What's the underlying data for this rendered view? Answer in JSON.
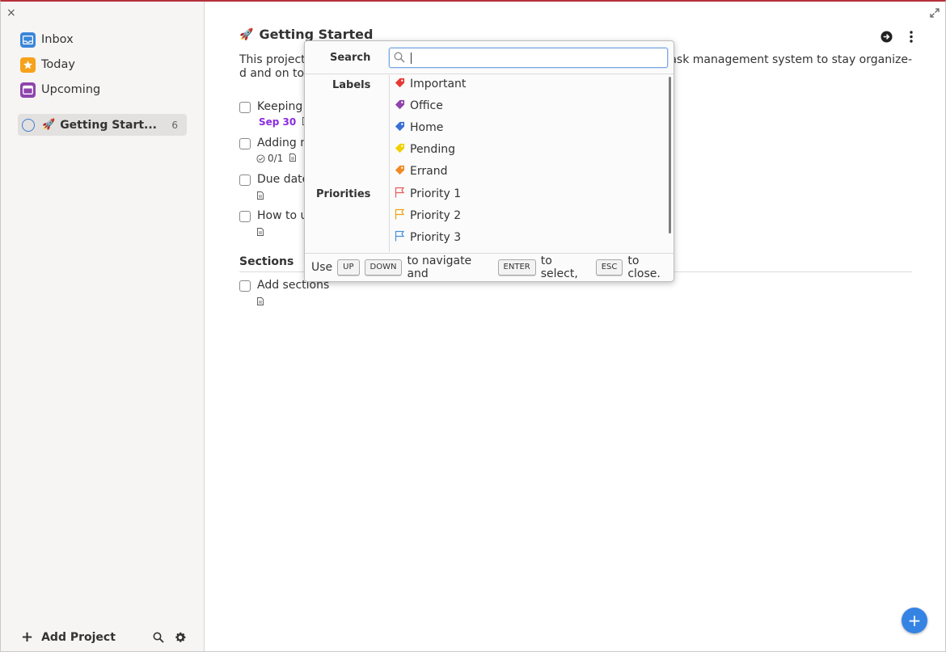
{
  "sidebar": {
    "close_glyph": "×",
    "nav": [
      {
        "label": "Inbox",
        "icon": "inbox-icon",
        "color": "#3a86d8"
      },
      {
        "label": "Today",
        "icon": "star-icon",
        "color": "#f6a21a"
      },
      {
        "label": "Upcoming",
        "icon": "calendar-icon",
        "color": "#8e44ad"
      }
    ],
    "project": {
      "emoji": "🚀",
      "label": "Getting Start...",
      "count": "6"
    },
    "footer": {
      "add_label": "Add Project",
      "plus": "+"
    }
  },
  "main": {
    "title_emoji": "🚀",
    "title": "Getting Started",
    "description_left": "This project",
    "description_right": "e task management system to stay organize-",
    "description_line2": "d and on top",
    "tasks": [
      {
        "text": "Keeping t",
        "due": "Sep 30"
      },
      {
        "text": "Adding n",
        "subtasks": "0/1"
      },
      {
        "text": "Due date"
      },
      {
        "text": "How to u"
      }
    ],
    "section_title": "Sections",
    "section_tasks": [
      {
        "text": "Add sections"
      }
    ],
    "fab_label": "+"
  },
  "popup": {
    "search_label": "Search",
    "search_value": "",
    "labels_heading": "Labels",
    "priorities_heading": "Priorities",
    "labels": [
      {
        "label": "Important",
        "color": "#e53935"
      },
      {
        "label": "Office",
        "color": "#8e44ad"
      },
      {
        "label": "Home",
        "color": "#3a6fd8"
      },
      {
        "label": "Pending",
        "color": "#f0d000"
      },
      {
        "label": "Errand",
        "color": "#f08a24"
      }
    ],
    "priorities": [
      {
        "label": "Priority 1",
        "color": "#e85a5a"
      },
      {
        "label": "Priority 2",
        "color": "#e8a317"
      },
      {
        "label": "Priority 3",
        "color": "#4a90d9"
      }
    ],
    "footer": {
      "use": "Use",
      "up": "UP",
      "down": "DOWN",
      "navigate": "to navigate and",
      "enter": "ENTER",
      "select": "to select,",
      "esc": "ESC",
      "close": "to close."
    }
  }
}
